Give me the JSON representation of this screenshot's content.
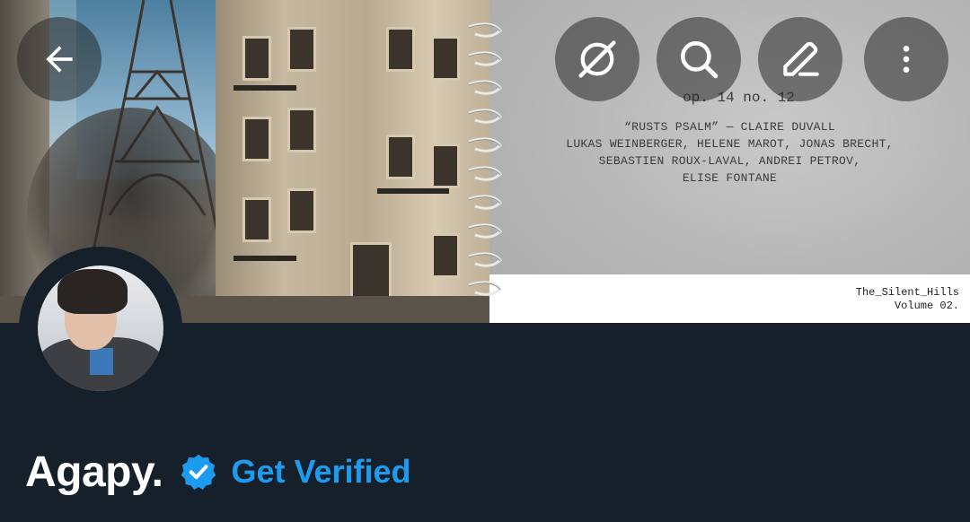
{
  "header": {
    "back_icon": "arrow-left-icon",
    "actions": [
      {
        "icon": "grok-icon"
      },
      {
        "icon": "search-icon"
      },
      {
        "icon": "edit-icon"
      },
      {
        "icon": "more-vertical-icon"
      }
    ]
  },
  "banner": {
    "score_opus": "op. 14 no. 12",
    "score_title": "“RUSTS PSALM” — CLAIRE DUVALL",
    "score_line_1": "LUKAS WEINBERGER, HELENE MAROT, JONAS BRECHT,",
    "score_line_2": "SEBASTIEN ROUX-LAVAL, ANDREI PETROV,",
    "score_line_3": "ELISE FONTANE",
    "credit_line_1": "The_Silent_Hills",
    "credit_line_2": "Volume 02."
  },
  "profile": {
    "display_name": "Agapy.",
    "verified_icon": "verified-badge-icon",
    "get_verified_label": "Get Verified"
  },
  "colors": {
    "background": "#15202b",
    "accent": "#1d9bf0",
    "name_text": "#ffffff"
  }
}
